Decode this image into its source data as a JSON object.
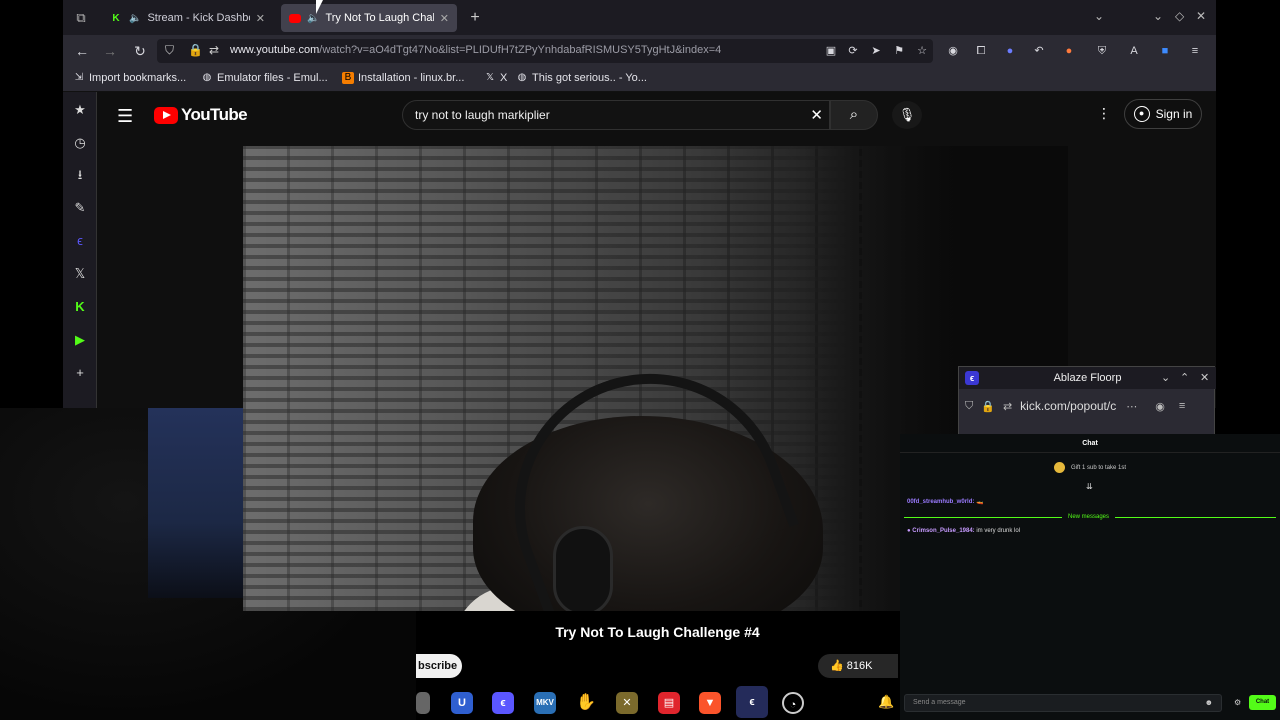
{
  "browser": {
    "tabs": [
      {
        "title": "Stream - Kick Dashboard",
        "favicon": "kick-logo-icon",
        "audio": true,
        "active": false
      },
      {
        "title": "Try Not To Laugh Challenge",
        "favicon": "youtube-logo-icon",
        "audio": true,
        "active": true
      }
    ],
    "url_domain": "www.youtube.com",
    "url_path": "/watch?v=aO4dTgt47No&list=PLIDUfH7tZPyYnhdabafRISMUSY5TygHtJ&index=4",
    "bookmarks": [
      {
        "label": "Import bookmarks...",
        "icon": "import-icon"
      },
      {
        "label": "Emulator files - Emul...",
        "icon": "globe-icon"
      },
      {
        "label": "Installation - linux.br...",
        "icon": "blogger-icon"
      },
      {
        "label": "X",
        "icon": "x-logo-icon"
      },
      {
        "label": "This got serious.. - Yo...",
        "icon": "globe-icon"
      }
    ]
  },
  "youtube": {
    "logo_text": "YouTube",
    "search_query": "try not to laugh markiplier",
    "sign_in_label": "Sign in",
    "video_title": "Try Not To Laugh Challenge #4",
    "subscribe_label": "bscribe",
    "likes": "816K"
  },
  "floorp_popup": {
    "title": "Ablaze Floorp",
    "url": "kick.com/popout/c"
  },
  "kick_chat": {
    "clipped_header": "Chat",
    "header": "Chat",
    "gift_text": "Gift 1 sub to take 1st",
    "new_messages_label": "New messages",
    "messages": [
      {
        "user": "00fd_streamhub_w0rld:",
        "text": "🚤",
        "user_color": "#9b7bff"
      },
      {
        "user": "Crimson_Pulse_1984:",
        "text": "im very drunk lol",
        "user_color": "#c79bff"
      }
    ],
    "input_placeholder": "Send a message",
    "send_label": "Chat"
  },
  "colors": {
    "kick_green": "#53fc18",
    "youtube_red": "#ff0000",
    "floorp_blue": "#3b38d4"
  }
}
